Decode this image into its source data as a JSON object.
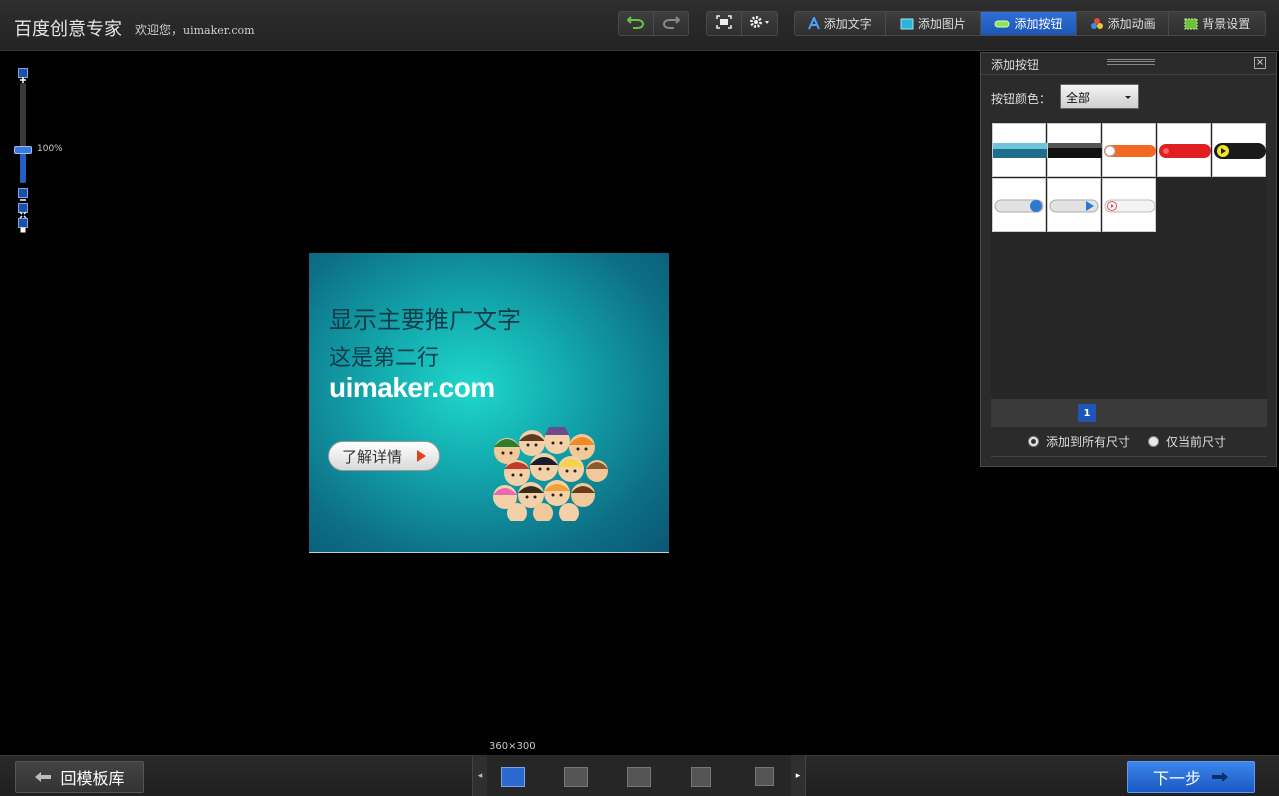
{
  "header": {
    "app_title": "百度创意专家",
    "welcome": "欢迎您，",
    "username": "uimaker.com"
  },
  "toolbar": {
    "undo": "undo-icon",
    "redo": "redo-icon",
    "fullscreen": "fullscreen-icon",
    "settings": "gear-icon",
    "tools": [
      {
        "label": "添加文字",
        "icon": "text-icon"
      },
      {
        "label": "添加图片",
        "icon": "image-icon"
      },
      {
        "label": "添加按钮",
        "icon": "button-icon",
        "active": true
      },
      {
        "label": "添加动画",
        "icon": "animation-icon"
      },
      {
        "label": "背景设置",
        "icon": "background-icon"
      }
    ]
  },
  "zoom": {
    "level_text": "100%",
    "level": 100
  },
  "banner": {
    "line1": "显示主要推广文字",
    "line2": "这是第二行",
    "line3": "uimaker.com",
    "cta": "了解详情"
  },
  "panel": {
    "title": "添加按钮",
    "color_label": "按钮颜色：",
    "color_value": "全部",
    "page": "1",
    "option_all": "添加到所有尺寸",
    "option_current": "仅当前尺寸",
    "selected_option": "all"
  },
  "footer": {
    "back_label": "回模板库",
    "size_label": "360×300",
    "next_label": "下一步"
  },
  "colors": {
    "accent": "#1d56b5",
    "bg": "#000000",
    "panel": "#2b2b2b"
  }
}
